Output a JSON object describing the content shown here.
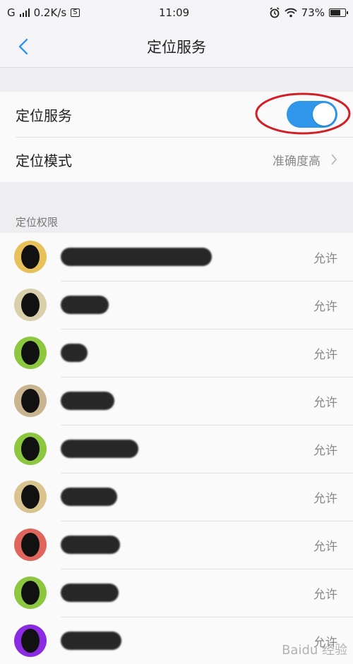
{
  "status_bar": {
    "network": "G",
    "speed": "0.2K/s",
    "s_icon": "S",
    "time": "11:09",
    "battery": "73%",
    "battery_level": 0.73
  },
  "nav": {
    "title": "定位服务"
  },
  "settings": {
    "location_service": {
      "label": "定位服务",
      "enabled": true
    },
    "location_mode": {
      "label": "定位模式",
      "value": "准确度高"
    }
  },
  "permissions": {
    "header": "定位权限",
    "items": [
      {
        "icon_color": "#e8c15a",
        "value": "允许"
      },
      {
        "icon_color": "#d9cfaa",
        "value": "允许"
      },
      {
        "icon_color": "#8dc63f",
        "value": "允许"
      },
      {
        "icon_color": "#c8b48f",
        "value": "允许"
      },
      {
        "icon_color": "#8dc63f",
        "value": "允许"
      },
      {
        "icon_color": "#d9c48f",
        "value": "允许"
      },
      {
        "icon_color": "#e0655d",
        "value": "允许"
      },
      {
        "icon_color": "#8dc63f",
        "value": "允许"
      },
      {
        "icon_color": "#8a2be2",
        "value": "允许"
      }
    ]
  },
  "colors": {
    "accent": "#2f96ea",
    "annotation": "#d21f26"
  },
  "watermark": "Baidu 经验"
}
